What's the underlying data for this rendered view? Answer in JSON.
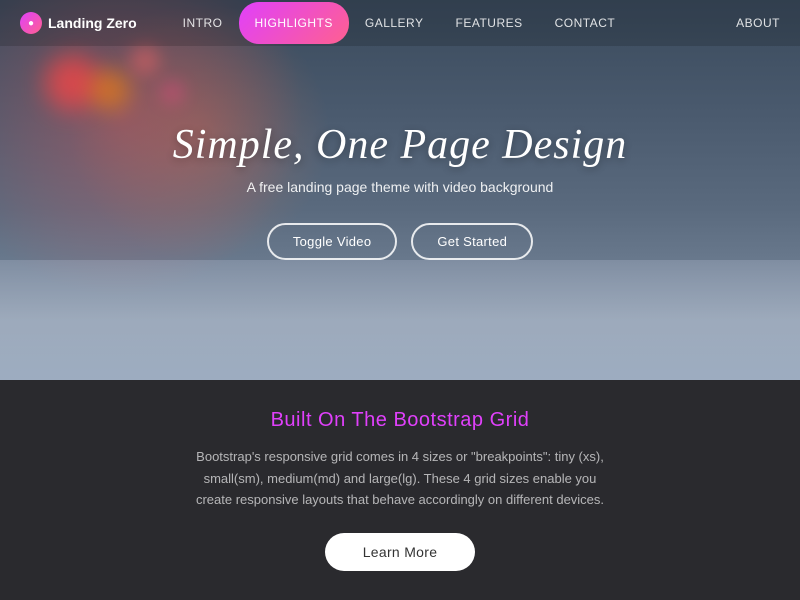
{
  "navbar": {
    "brand": "Landing Zero",
    "brand_icon": "●",
    "links": [
      {
        "id": "intro",
        "label": "INTRO",
        "active": false
      },
      {
        "id": "highlights",
        "label": "HIGHLIGHTS",
        "active": true
      },
      {
        "id": "gallery",
        "label": "GALLERY",
        "active": false
      },
      {
        "id": "features",
        "label": "FEATURES",
        "active": false
      },
      {
        "id": "contact",
        "label": "CONTACT",
        "active": false
      }
    ],
    "about_label": "ABOUT"
  },
  "hero": {
    "title": "Simple, One Page Design",
    "subtitle": "A free landing page theme with video background",
    "btn_toggle": "Toggle Video",
    "btn_started": "Get Started"
  },
  "content": {
    "title": "Built On The Bootstrap Grid",
    "body": "Bootstrap's responsive grid comes in 4 sizes or \"breakpoints\": tiny (xs), small(sm), medium(md) and large(lg). These 4 grid sizes enable you create responsive layouts that behave accordingly on different devices.",
    "learn_more": "Learn More"
  }
}
